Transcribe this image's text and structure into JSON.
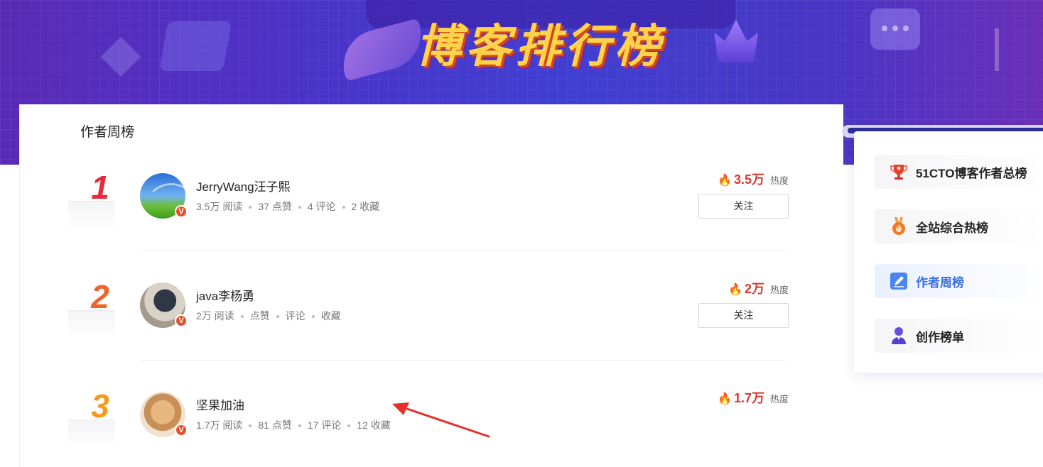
{
  "banner": {
    "title": "博客排行榜"
  },
  "section": {
    "title": "作者周榜"
  },
  "ranks": [
    {
      "rank": "1",
      "rank_color": "#e8283c",
      "name": "JerryWang汪子熙",
      "reads": "3.5万 阅读",
      "likes": "37 点赞",
      "comments": "4 评论",
      "favorites": "2 收藏",
      "heat_value": "3.5万",
      "heat_label": "热度",
      "follow_label": "关注",
      "avatar_icon": "sky-rainbow-avatar",
      "badge": "V"
    },
    {
      "rank": "2",
      "rank_color": "#f0652a",
      "name": "java李杨勇",
      "reads": "2万 阅读",
      "likes": "点赞",
      "comments": "评论",
      "favorites": "收藏",
      "heat_value": "2万",
      "heat_label": "热度",
      "follow_label": "关注",
      "avatar_icon": "photographer-avatar",
      "badge": "V"
    },
    {
      "rank": "3",
      "rank_color": "#f59a1c",
      "name": "坚果加油",
      "reads": "1.7万 阅读",
      "likes": "81 点赞",
      "comments": "17 评论",
      "favorites": "12 收藏",
      "heat_value": "1.7万",
      "heat_label": "热度",
      "avatar_icon": "dog-avatar",
      "badge": "V"
    }
  ],
  "side": {
    "items": [
      {
        "label": "51CTO博客作者总榜",
        "icon": "trophy-icon",
        "active": false
      },
      {
        "label": "全站综合热榜",
        "icon": "medal-icon",
        "active": false
      },
      {
        "label": "作者周榜",
        "icon": "pen-edit-icon",
        "active": true
      },
      {
        "label": "创作榜单",
        "icon": "person-icon",
        "active": false
      }
    ]
  },
  "colors": {
    "heat": "#d73a2c",
    "active_side": "#3b6fe0",
    "banner": "#4a33c9"
  }
}
